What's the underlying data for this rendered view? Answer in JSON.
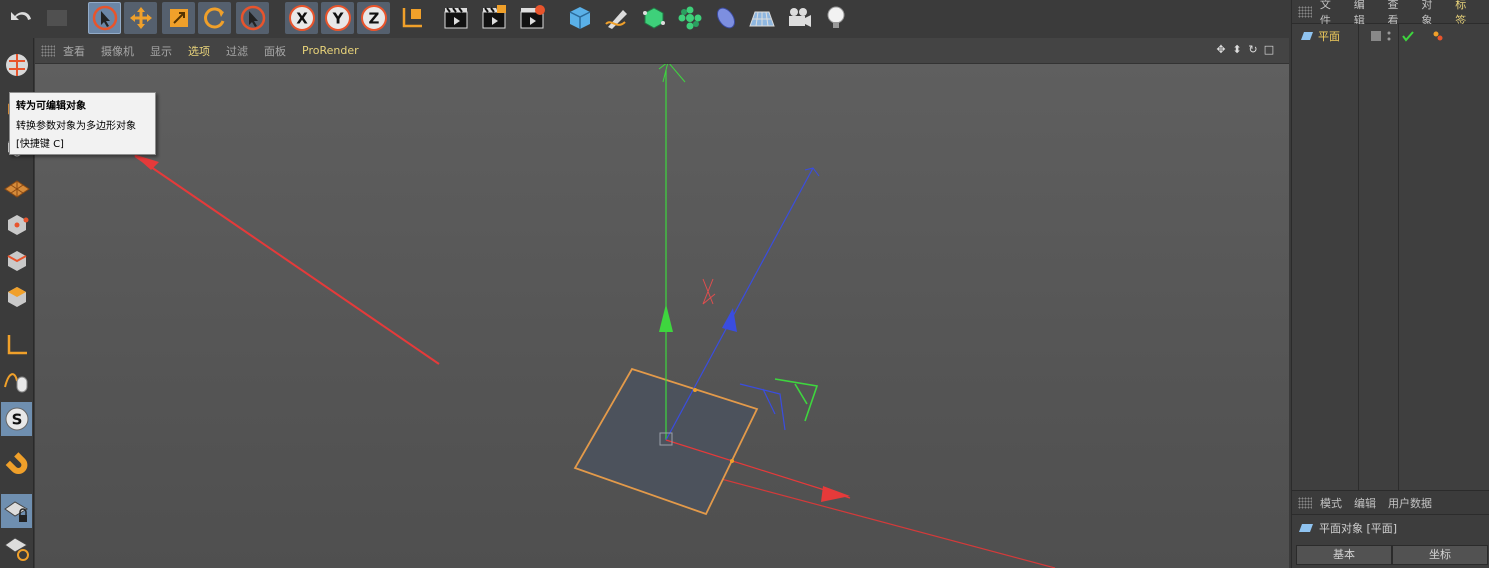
{
  "toolbar": {
    "undo_icon": "undo-icon",
    "redo_icon": "redo-icon",
    "tools": [
      "live-selection-icon",
      "move-icon",
      "scale-icon",
      "rotate-icon",
      "recent-tool-icon"
    ],
    "axis_x": "X",
    "axis_y": "Y",
    "axis_z": "Z",
    "coord_icon": "world-coordinate-icon",
    "render": [
      "render-view-icon",
      "render-picture-viewer-icon",
      "render-settings-icon"
    ],
    "objects": [
      "cube-icon",
      "pen-icon",
      "subdivision-icon",
      "cloner-icon",
      "deformer-icon",
      "floor-icon",
      "camera-icon",
      "light-icon"
    ]
  },
  "left_toolbar": {
    "items": [
      "make-editable-icon",
      "model-mode-icon",
      "texture-mode-icon",
      "workplane-icon",
      "points-mode-icon",
      "edges-mode-icon",
      "polygons-mode-icon",
      "axis-mode-icon",
      "tweak-mode-icon",
      "snap-icon",
      "magnet-icon",
      "lock-workplane-icon",
      "planar-workplane-icon"
    ]
  },
  "viewport": {
    "menu": [
      "查看",
      "摄像机",
      "显示",
      "选项",
      "过滤",
      "面板",
      "ProRender"
    ]
  },
  "tooltip": {
    "title": "转为可编辑对象",
    "description": "转换参数对象为多边形对象",
    "shortcut": "[快捷键 C]"
  },
  "object_manager": {
    "menu": [
      "文件",
      "编辑",
      "查看",
      "对象",
      "标签"
    ],
    "object_name": "平面"
  },
  "attribute_manager": {
    "menu": [
      "模式",
      "编辑",
      "用户数据"
    ],
    "object_label": "平面对象 [平面]",
    "tabs": [
      "基本",
      "坐标"
    ]
  },
  "colors": {
    "x_axis": "#e53a3a",
    "y_axis": "#3ed63e",
    "z_axis": "#3a4de0",
    "selection_outline": "#e39a4a",
    "accent_text": "#e8d37a"
  }
}
